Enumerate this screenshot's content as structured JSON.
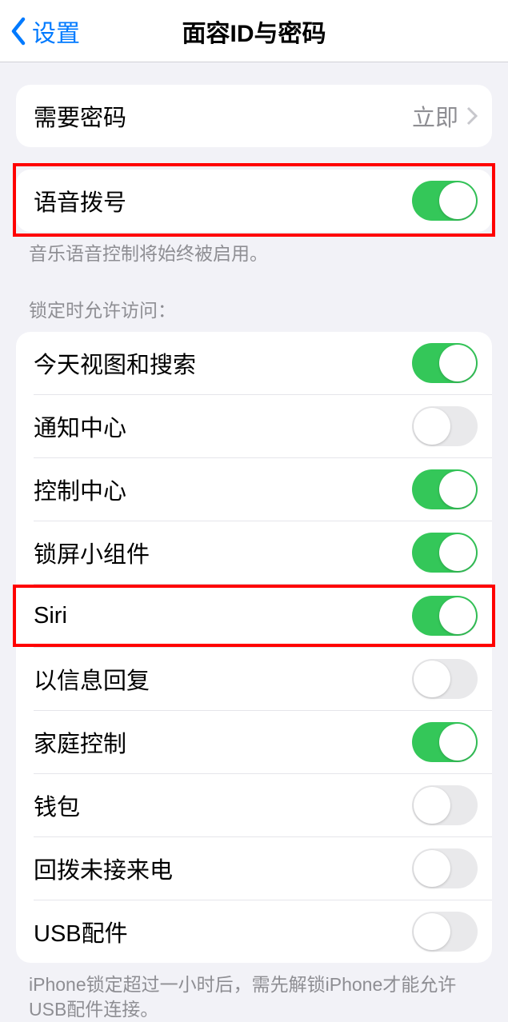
{
  "navbar": {
    "back_label": "设置",
    "title": "面容ID与密码"
  },
  "require_passcode": {
    "label": "需要密码",
    "value": "立即"
  },
  "voice_dial": {
    "label": "语音拨号",
    "enabled": true,
    "footer": "音乐语音控制将始终被启用。"
  },
  "lock_access": {
    "header": "锁定时允许访问：",
    "items": [
      {
        "label": "今天视图和搜索",
        "enabled": true
      },
      {
        "label": "通知中心",
        "enabled": false
      },
      {
        "label": "控制中心",
        "enabled": true
      },
      {
        "label": "锁屏小组件",
        "enabled": true
      },
      {
        "label": "Siri",
        "enabled": true
      },
      {
        "label": "以信息回复",
        "enabled": false
      },
      {
        "label": "家庭控制",
        "enabled": true
      },
      {
        "label": "钱包",
        "enabled": false
      },
      {
        "label": "回拨未接来电",
        "enabled": false
      },
      {
        "label": "USB配件",
        "enabled": false
      }
    ],
    "footer": "iPhone锁定超过一小时后，需先解锁iPhone才能允许USB配件连接。"
  }
}
